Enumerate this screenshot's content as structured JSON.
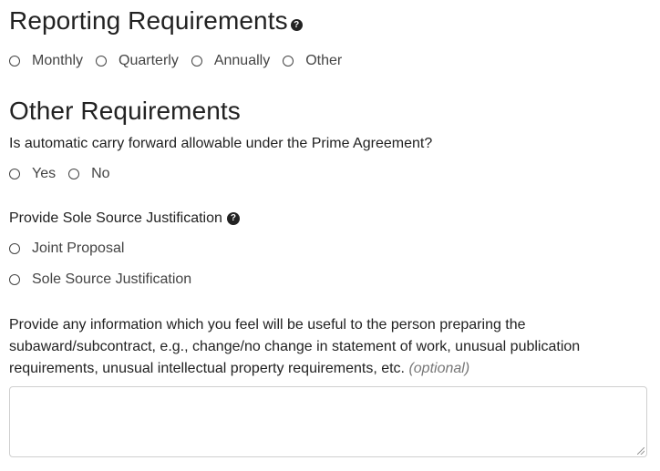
{
  "reporting": {
    "title": "Reporting Requirements",
    "help_icon": "question-circle-icon",
    "options": [
      "Monthly",
      "Quarterly",
      "Annually",
      "Other"
    ]
  },
  "other": {
    "title": "Other Requirements",
    "carry_forward": {
      "question": "Is automatic carry forward allowable under the Prime Agreement?",
      "options": [
        "Yes",
        "No"
      ]
    },
    "sole_source": {
      "question": "Provide Sole Source Justification",
      "help_icon": "question-circle-icon",
      "options": [
        "Joint Proposal",
        "Sole Source Justification"
      ]
    },
    "info": {
      "question": "Provide any information which you feel will be useful to the person preparing the subaward/subcontract, e.g., change/no change in statement of work, unusual publication requirements, unusual intellectual property requirements, etc.",
      "optional": "(optional)",
      "value": ""
    }
  }
}
